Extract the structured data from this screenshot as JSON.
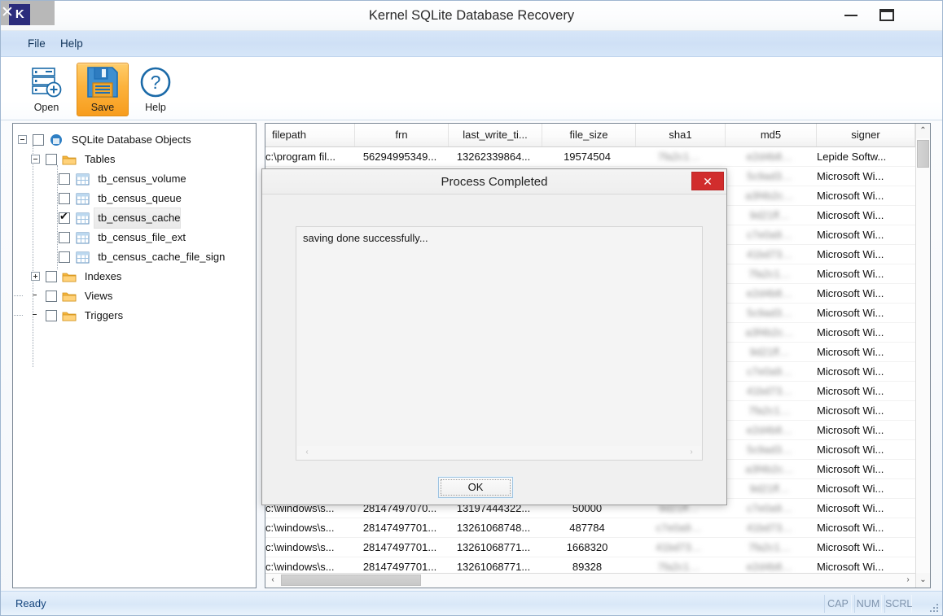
{
  "window": {
    "title": "Kernel SQLite Database Recovery",
    "app_icon_letter": "K",
    "minimize_label": "",
    "maximize_label": "",
    "close_label": "✕"
  },
  "menu": {
    "items": [
      {
        "label": "File"
      },
      {
        "label": "Help"
      }
    ]
  },
  "toolbar": {
    "open_label": "Open",
    "save_label": "Save",
    "help_label": "Help",
    "active_button": "Save",
    "active_color": "#f79d1e"
  },
  "logo": {
    "brand": "Kernel",
    "product": "SQLite Database Recovery",
    "brand_color": "#1c4e8f"
  },
  "tree": {
    "root": {
      "label": "SQLite Database Objects",
      "checked": false,
      "expanded": true
    },
    "nodes": [
      {
        "label": "Tables",
        "checked": false,
        "expanded": true,
        "icon": "folder-icon",
        "level": 1
      },
      {
        "label": "tb_census_volume",
        "checked": false,
        "icon": "table-icon",
        "level": 2
      },
      {
        "label": "tb_census_queue",
        "checked": false,
        "icon": "table-icon",
        "level": 2
      },
      {
        "label": "tb_census_cache",
        "checked": true,
        "icon": "table-icon",
        "level": 2,
        "selected": true
      },
      {
        "label": "tb_census_file_ext",
        "checked": false,
        "icon": "table-icon",
        "level": 2
      },
      {
        "label": "tb_census_cache_file_sign",
        "checked": false,
        "icon": "table-icon",
        "level": 2
      },
      {
        "label": "Indexes",
        "checked": false,
        "expanded": false,
        "icon": "folder-icon",
        "level": 1
      },
      {
        "label": "Views",
        "checked": false,
        "icon": "folder-icon",
        "level": 1
      },
      {
        "label": "Triggers",
        "checked": false,
        "icon": "folder-icon",
        "level": 1
      }
    ]
  },
  "grid": {
    "columns": [
      {
        "key": "filepath",
        "label": "filepath"
      },
      {
        "key": "frn",
        "label": "frn"
      },
      {
        "key": "last_write_time",
        "label": "last_write_ti..."
      },
      {
        "key": "file_size",
        "label": "file_size"
      },
      {
        "key": "sha1",
        "label": "sha1"
      },
      {
        "key": "md5",
        "label": "md5"
      },
      {
        "key": "signer",
        "label": "signer"
      }
    ],
    "rows": [
      {
        "filepath": "c:\\program fil...",
        "frn": "56294995349...",
        "last_write_time": "13262339864...",
        "file_size": "19574504",
        "sha1": "",
        "md5": "",
        "signer": "Lepide Softw..."
      },
      {
        "filepath": "",
        "frn": "",
        "last_write_time": "",
        "file_size": "",
        "sha1": "",
        "md5": "",
        "signer": "Microsoft Wi..."
      },
      {
        "filepath": "",
        "frn": "",
        "last_write_time": "",
        "file_size": "",
        "sha1": "",
        "md5": "",
        "signer": "Microsoft Wi..."
      },
      {
        "filepath": "",
        "frn": "",
        "last_write_time": "",
        "file_size": "",
        "sha1": "",
        "md5": "",
        "signer": "Microsoft Wi..."
      },
      {
        "filepath": "",
        "frn": "",
        "last_write_time": "",
        "file_size": "",
        "sha1": "",
        "md5": "",
        "signer": "Microsoft Wi..."
      },
      {
        "filepath": "",
        "frn": "",
        "last_write_time": "",
        "file_size": "",
        "sha1": "",
        "md5": "",
        "signer": "Microsoft Wi..."
      },
      {
        "filepath": "",
        "frn": "",
        "last_write_time": "",
        "file_size": "",
        "sha1": "",
        "md5": "",
        "signer": "Microsoft Wi..."
      },
      {
        "filepath": "",
        "frn": "",
        "last_write_time": "",
        "file_size": "",
        "sha1": "",
        "md5": "",
        "signer": "Microsoft Wi..."
      },
      {
        "filepath": "",
        "frn": "",
        "last_write_time": "",
        "file_size": "",
        "sha1": "",
        "md5": "",
        "signer": "Microsoft Wi..."
      },
      {
        "filepath": "",
        "frn": "",
        "last_write_time": "",
        "file_size": "",
        "sha1": "",
        "md5": "",
        "signer": "Microsoft Wi..."
      },
      {
        "filepath": "",
        "frn": "",
        "last_write_time": "",
        "file_size": "",
        "sha1": "",
        "md5": "",
        "signer": "Microsoft Wi..."
      },
      {
        "filepath": "",
        "frn": "",
        "last_write_time": "",
        "file_size": "",
        "sha1": "",
        "md5": "",
        "signer": "Microsoft Wi..."
      },
      {
        "filepath": "",
        "frn": "",
        "last_write_time": "",
        "file_size": "",
        "sha1": "",
        "md5": "",
        "signer": "Microsoft Wi..."
      },
      {
        "filepath": "",
        "frn": "",
        "last_write_time": "",
        "file_size": "",
        "sha1": "",
        "md5": "",
        "signer": "Microsoft Wi..."
      },
      {
        "filepath": "",
        "frn": "",
        "last_write_time": "",
        "file_size": "",
        "sha1": "",
        "md5": "",
        "signer": "Microsoft Wi..."
      },
      {
        "filepath": "",
        "frn": "",
        "last_write_time": "",
        "file_size": "",
        "sha1": "",
        "md5": "",
        "signer": "Microsoft Wi..."
      },
      {
        "filepath": "",
        "frn": "",
        "last_write_time": "",
        "file_size": "",
        "sha1": "",
        "md5": "",
        "signer": "Microsoft Wi..."
      },
      {
        "filepath": "",
        "frn": "",
        "last_write_time": "",
        "file_size": "",
        "sha1": "",
        "md5": "",
        "signer": "Microsoft Wi..."
      },
      {
        "filepath": "c:\\windows\\s...",
        "frn": "28147497070...",
        "last_write_time": "13197444322...",
        "file_size": "50000",
        "sha1": "",
        "md5": "",
        "signer": "Microsoft Wi..."
      },
      {
        "filepath": "c:\\windows\\s...",
        "frn": "28147497701...",
        "last_write_time": "13261068748...",
        "file_size": "487784",
        "sha1": "",
        "md5": "",
        "signer": "Microsoft Wi..."
      },
      {
        "filepath": "c:\\windows\\s...",
        "frn": "28147497701...",
        "last_write_time": "13261068771...",
        "file_size": "1668320",
        "sha1": "",
        "md5": "",
        "signer": "Microsoft Wi..."
      },
      {
        "filepath": "c:\\windows\\s...",
        "frn": "28147497701...",
        "last_write_time": "13261068771...",
        "file_size": "89328",
        "sha1": "",
        "md5": "",
        "signer": "Microsoft Wi..."
      }
    ],
    "scroll_up_glyph": "⌃",
    "scroll_down_glyph": "⌄",
    "scroll_left_glyph": "‹",
    "scroll_right_glyph": "›"
  },
  "dialog": {
    "title": "Process Completed",
    "close_label": "✕",
    "message": "saving done successfully...",
    "ok_label": "OK",
    "scroll_left_glyph": "‹",
    "scroll_right_glyph": "›",
    "close_color": "#d12d2d"
  },
  "statusbar": {
    "text": "Ready",
    "indicators": [
      {
        "label": "CAP"
      },
      {
        "label": "NUM"
      },
      {
        "label": "SCRL"
      }
    ]
  }
}
